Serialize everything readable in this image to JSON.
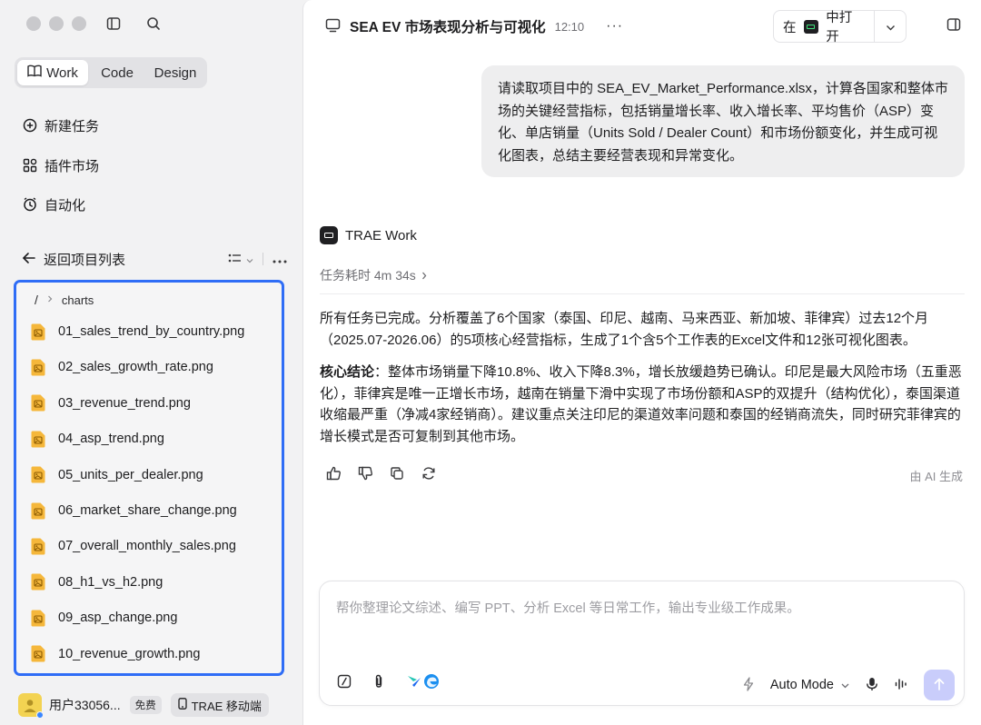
{
  "sidebar": {
    "mode_tabs": [
      {
        "label": "Work",
        "active": true
      },
      {
        "label": "Code",
        "active": false
      },
      {
        "label": "Design",
        "active": false
      }
    ],
    "nav": [
      {
        "label": "新建任务",
        "icon": "plus-circle-icon"
      },
      {
        "label": "插件市场",
        "icon": "plugins-icon"
      },
      {
        "label": "自动化",
        "icon": "clock-icon"
      }
    ],
    "back_label": "返回项目列表",
    "breadcrumb": {
      "root": "/",
      "folder": "charts"
    },
    "files": [
      "01_sales_trend_by_country.png",
      "02_sales_growth_rate.png",
      "03_revenue_trend.png",
      "04_asp_trend.png",
      "05_units_per_dealer.png",
      "06_market_share_change.png",
      "07_overall_monthly_sales.png",
      "08_h1_vs_h2.png",
      "09_asp_change.png",
      "10_revenue_growth.png"
    ],
    "user": {
      "name": "用户33056...",
      "plan": "免费",
      "mobile_label": "TRAE 移动端"
    }
  },
  "main": {
    "title": "SEA EV 市场表现分析与可视化",
    "time": "12:10",
    "more": "···",
    "open_in": {
      "prefix": "在",
      "label": "中打开"
    },
    "user_message": "请读取项目中的 SEA_EV_Market_Performance.xlsx，计算各国家和整体市场的关键经营指标，包括销量增长率、收入增长率、平均售价（ASP）变化、单店销量（Units Sold / Dealer Count）和市场份额变化，并生成可视化图表，总结主要经营表现和异常变化。",
    "agent_name": "TRAE Work",
    "duration": "任务耗时 4m 34s",
    "para1": "所有任务已完成。分析覆盖了6个国家（泰国、印尼、越南、马来西亚、新加坡、菲律宾）过去12个月（2025.07-2026.06）的5项核心经营指标，生成了1个含5个工作表的Excel文件和12张可视化图表。",
    "para2_label": "核心结论",
    "para2_text": "：整体市场销量下降10.8%、收入下降8.3%，增长放缓趋势已确认。印尼是最大风险市场（五重恶化），菲律宾是唯一正增长市场，越南在销量下滑中实现了市场份额和ASP的双提升（结构优化），泰国渠道收缩最严重（净减4家经销商）。建议重点关注印尼的渠道效率问题和泰国的经销商流失，同时研究菲律宾的增长模式是否可复制到其他市场。",
    "ai_generated": "由 AI 生成",
    "composer": {
      "placeholder": "帮你整理论文综述、编写 PPT、分析 Excel 等日常工作，输出专业级工作成果。",
      "mode": "Auto Mode"
    }
  },
  "colors": {
    "accent": "#2f6df6",
    "send": "#c9cdfb",
    "file_icon": "#f5b73b"
  }
}
